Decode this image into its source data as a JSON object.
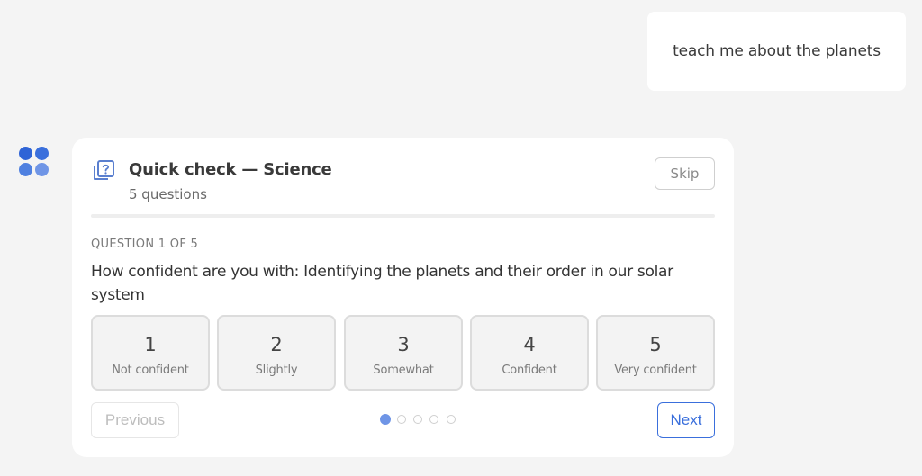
{
  "user_message": "teach me about the planets",
  "quiz": {
    "icon": "question-card-icon",
    "title": "Quick check — Science",
    "subtitle": "5 questions",
    "skip_label": "Skip",
    "question_counter": "QUESTION 1 OF 5",
    "question_text": "How confident are you with: Identifying the planets and their order in our solar system",
    "options": [
      {
        "value": "1",
        "label": "Not confident"
      },
      {
        "value": "2",
        "label": "Slightly"
      },
      {
        "value": "3",
        "label": "Somewhat"
      },
      {
        "value": "4",
        "label": "Confident"
      },
      {
        "value": "5",
        "label": "Very confident"
      }
    ],
    "previous_label": "Previous",
    "next_label": "Next",
    "current_question": 1,
    "total_questions": 5
  },
  "colors": {
    "accent": "#3a6fdc",
    "background": "#f4f4f4",
    "card": "#ffffff"
  }
}
